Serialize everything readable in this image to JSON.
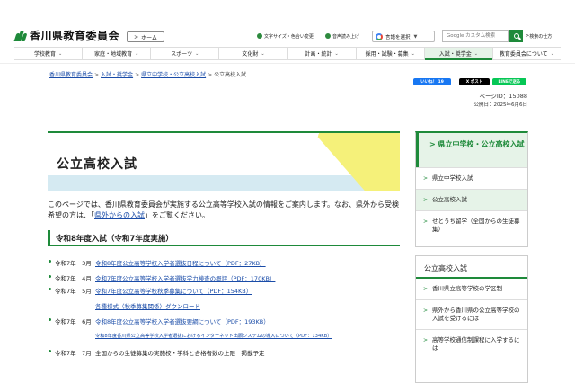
{
  "header": {
    "logo_text": "香川県教育委員会",
    "home_label": "ホーム",
    "text_size_label": "文字サイズ・色合い変更",
    "read_aloud_label": "音声読み上げ",
    "translate_label": "言語を選択",
    "search_placeholder": "Google カスタム検索",
    "search_how_label": "検索の仕方",
    "brand_color": "#1e8a3a"
  },
  "nav": [
    {
      "label": "学校教育"
    },
    {
      "label": "家庭・地域教育"
    },
    {
      "label": "スポーツ"
    },
    {
      "label": "文化財"
    },
    {
      "label": "計画・統計"
    },
    {
      "label": "採用・試験・募集"
    },
    {
      "label": "入試・奨学金"
    },
    {
      "label": "教育委員会について"
    }
  ],
  "breadcrumb": {
    "items": [
      "香川県教育委員会",
      "入試・奨学金",
      "県立中学校・公立高校入試"
    ],
    "current": "公立高校入試"
  },
  "share": {
    "like": "いいね！ 19",
    "post": "X ポスト",
    "line": "LINEで送る"
  },
  "meta": {
    "page_id": "ページID：15088",
    "published": "公開日：2025年6月6日"
  },
  "main": {
    "title": "公立高校入試",
    "intro_before": "このページでは、香川県教育委員会が実施する公立高等学校入試の情報をご案内します。なお、県外から受検希望の方は、",
    "intro_link": "県外からの入試",
    "intro_after": "をご覧ください。",
    "section_heading": "令和8年度入試（令和7年度実施）",
    "items": [
      {
        "date": "令和7年　3月",
        "text": "令和8年度公立高等学校入学者選抜日程について（PDF：27KB）",
        "link": true
      },
      {
        "date": "令和7年　4月",
        "text": "令和7年度公立高等学校入学者選抜学力検査の概評（PDF：170KB）",
        "link": true
      },
      {
        "date": "令和7年　5月",
        "text": "令和7年度公立高等学校秋季募集について（PDF：154KB）",
        "link": true
      },
      {
        "date": "令和7年　6月",
        "text": "令和8年度公立高等学校入学者選抜要綱について（PDF：193KB）",
        "link": true
      },
      {
        "date": "令和7年　7月",
        "text": "全国からの生徒募集の実施校・学科と合格者数の上限　掲載予定",
        "link": false
      }
    ],
    "sub_items": [
      "各種様式（秋季募集関係）ダウンロード",
      "令和8年度香川県公立高等学校入学者選抜におけるインターネット出願システムの導入について（PDF：134KB）"
    ]
  },
  "sidebar": {
    "box1_title": "県立中学校・公立高校入試",
    "box1_links": [
      "県立中学校入試",
      "公立高校入試",
      "せとうち留学（全国からの生徒募集）"
    ],
    "box2_title": "公立高校入試",
    "box2_links": [
      "香川県立高等学校の学区制",
      "県外から香川県の公立高等学校の入試を受けるには",
      "高等学校通信制課程に入学するには"
    ]
  }
}
